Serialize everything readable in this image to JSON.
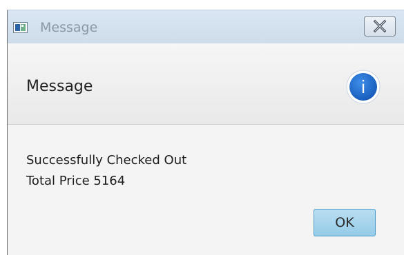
{
  "window": {
    "title": "Message",
    "app_icon": "window-icon",
    "close_icon": "close-icon"
  },
  "header": {
    "title": "Message",
    "icon": "info-icon",
    "icon_glyph": "i",
    "icon_color": "#1d6fd0"
  },
  "content": {
    "line1": "Successfully Checked Out",
    "line2": "Total Price 5164"
  },
  "buttons": {
    "ok_label": "OK"
  }
}
